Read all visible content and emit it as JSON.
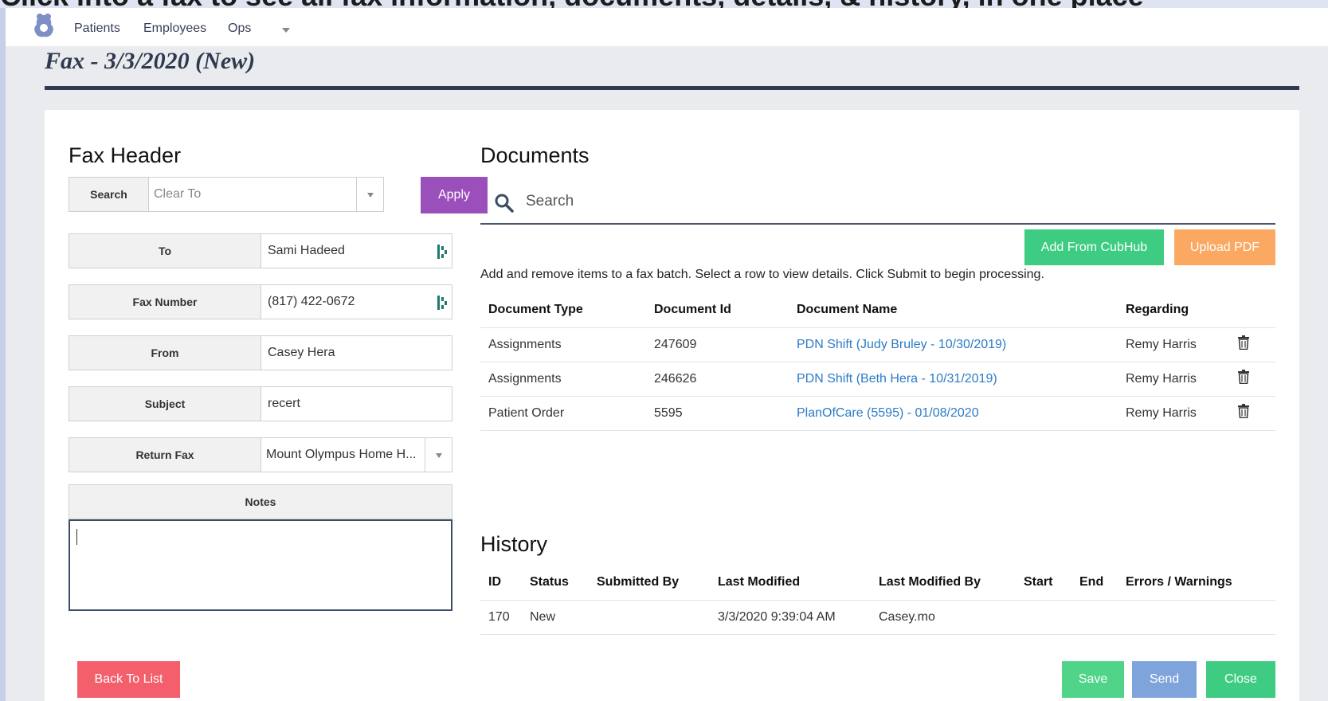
{
  "banner": {
    "text": "Click into a fax to see all fax information, documents, details, & history, in one place"
  },
  "nav": {
    "items": [
      "Patients",
      "Employees",
      "Ops"
    ]
  },
  "page": {
    "title": "Fax - 3/3/2020 (New)"
  },
  "fax_header": {
    "title": "Fax Header",
    "search_label": "Search",
    "search_placeholder": "Clear To",
    "apply_label": "Apply",
    "fields": {
      "to": {
        "label": "To",
        "value": "Sami Hadeed"
      },
      "fax_number": {
        "label": "Fax Number",
        "value": "(817) 422-0672"
      },
      "from": {
        "label": "From",
        "value": "Casey Hera"
      },
      "subject": {
        "label": "Subject",
        "value": "recert"
      },
      "return_fax": {
        "label": "Return Fax",
        "value": "Mount Olympus Home H..."
      }
    },
    "notes_label": "Notes"
  },
  "documents": {
    "title": "Documents",
    "search_placeholder": "Search",
    "add_button": "Add From CubHub",
    "upload_button": "Upload PDF",
    "help_text": "Add and remove items to a fax batch. Select a row to view details. Click Submit to begin processing.",
    "columns": [
      "Document Type",
      "Document Id",
      "Document Name",
      "Regarding"
    ],
    "rows": [
      {
        "type": "Assignments",
        "id": "247609",
        "name": "PDN Shift (Judy Bruley - 10/30/2019)",
        "regarding": "Remy Harris"
      },
      {
        "type": "Assignments",
        "id": "246626",
        "name": "PDN Shift (Beth Hera - 10/31/2019)",
        "regarding": "Remy Harris"
      },
      {
        "type": "Patient Order",
        "id": "5595",
        "name": "PlanOfCare (5595) - 01/08/2020",
        "regarding": "Remy Harris"
      }
    ]
  },
  "history": {
    "title": "History",
    "columns": [
      "ID",
      "Status",
      "Submitted By",
      "Last Modified",
      "Last Modified By",
      "Start",
      "End",
      "Errors / Warnings"
    ],
    "rows": [
      {
        "id": "170",
        "status": "New",
        "submitted_by": "",
        "last_modified": "3/3/2020 9:39:04 AM",
        "last_modified_by": "Casey.mo",
        "start": "",
        "end": "",
        "errors": ""
      }
    ]
  },
  "footer": {
    "back_label": "Back To List",
    "save_label": "Save",
    "send_label": "Send",
    "close_label": "Close"
  },
  "colors": {
    "apply": "#9b4fba",
    "add": "#3ecc82",
    "upload": "#fba862",
    "back": "#f45f6c",
    "save": "#4fd48a",
    "send": "#7fa4dc",
    "close": "#3ecc82",
    "link": "#2b7bc6"
  }
}
